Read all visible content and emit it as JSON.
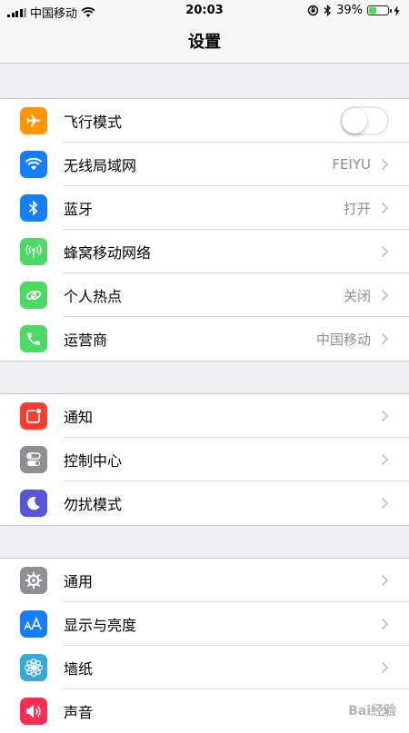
{
  "status_bar": {
    "carrier": "中国移动",
    "time": "20:03",
    "battery": "39%",
    "battery_level": 0.39
  },
  "nav": {
    "title": "设置"
  },
  "groups": [
    {
      "items": [
        {
          "label": "飞行模式",
          "icon": "airplane-icon",
          "color": "#ff9500",
          "toggle": false
        },
        {
          "label": "无线局域网",
          "icon": "wifi-icon",
          "color": "#147efb",
          "value": "FEIYU"
        },
        {
          "label": "蓝牙",
          "icon": "bluetooth-icon",
          "color": "#147efb",
          "value": "打开"
        },
        {
          "label": "蜂窝移动网络",
          "icon": "cellular-antenna-icon",
          "color": "#4cd964",
          "value": ""
        },
        {
          "label": "个人热点",
          "icon": "hotspot-link-icon",
          "color": "#4cd964",
          "value": "关闭"
        },
        {
          "label": "运营商",
          "icon": "phone-icon",
          "color": "#4cd964",
          "value": "中国移动"
        }
      ]
    },
    {
      "items": [
        {
          "label": "通知",
          "icon": "notifications-icon",
          "color": "#ff3b30"
        },
        {
          "label": "控制中心",
          "icon": "control-center-icon",
          "color": "#8e8e93"
        },
        {
          "label": "勿扰模式",
          "icon": "moon-icon",
          "color": "#5856d6"
        }
      ]
    },
    {
      "items": [
        {
          "label": "通用",
          "icon": "gear-icon",
          "color": "#8e8e93"
        },
        {
          "label": "显示与亮度",
          "icon": "text-size-icon",
          "color": "#147efb"
        },
        {
          "label": "墙纸",
          "icon": "wallpaper-flower-icon",
          "color": "#34aadc"
        },
        {
          "label": "声音",
          "icon": "speaker-icon",
          "color": "#ff2d55"
        }
      ]
    }
  ],
  "watermark": "Bai经验"
}
